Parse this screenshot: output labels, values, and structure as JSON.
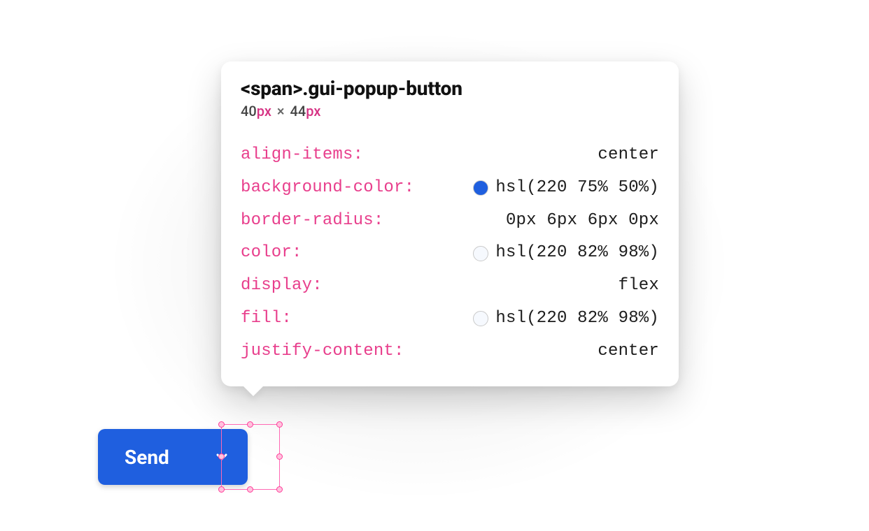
{
  "tooltip": {
    "selector": "<span>.gui-popup-button",
    "dims": {
      "w_num": "40",
      "w_unit": "px",
      "times": "×",
      "h_num": "44",
      "h_unit": "px"
    },
    "props": [
      {
        "name": "align-items",
        "value": "center",
        "swatch": null
      },
      {
        "name": "background-color",
        "value": "hsl(220 75% 50%)",
        "swatch": "#1f5fdf"
      },
      {
        "name": "border-radius",
        "value": "0px 6px 6px 0px",
        "swatch": null
      },
      {
        "name": "color",
        "value": "hsl(220 82% 98%)",
        "swatch": "#f6f9fe"
      },
      {
        "name": "display",
        "value": "flex",
        "swatch": null
      },
      {
        "name": "fill",
        "value": "hsl(220 82% 98%)",
        "swatch": "#f6f9fe"
      },
      {
        "name": "justify-content",
        "value": "center",
        "swatch": null
      }
    ]
  },
  "button": {
    "send_label": "Send"
  },
  "colors": {
    "accent": "#1f5fdf",
    "selection": "#ff69b4"
  }
}
